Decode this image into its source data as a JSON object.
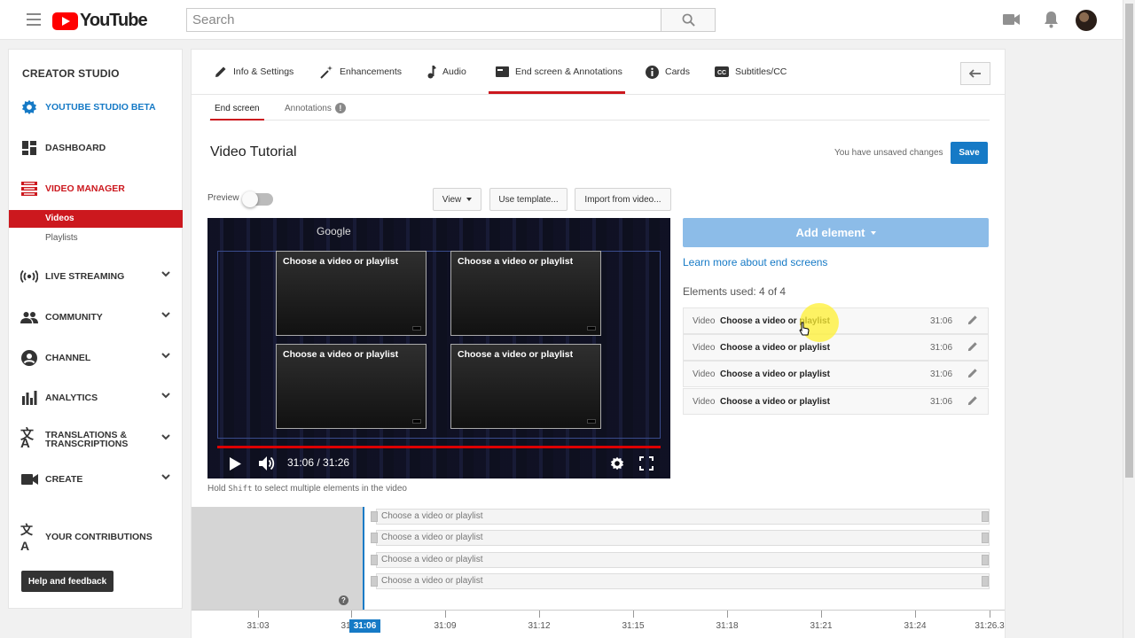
{
  "topbar": {
    "logo_text": "YouTube",
    "search_placeholder": "Search"
  },
  "sidebar": {
    "title": "CREATOR STUDIO",
    "items": [
      {
        "label": "YOUTUBE STUDIO BETA",
        "icon": "gear-icon",
        "accent": true
      },
      {
        "label": "DASHBOARD",
        "icon": "dashboard-icon"
      },
      {
        "label": "VIDEO MANAGER",
        "icon": "video-manager-icon",
        "accent": true
      },
      {
        "label": "LIVE STREAMING",
        "icon": "live-icon"
      },
      {
        "label": "COMMUNITY",
        "icon": "people-icon"
      },
      {
        "label": "CHANNEL",
        "icon": "account-icon"
      },
      {
        "label": "ANALYTICS",
        "icon": "bar-chart-icon"
      },
      {
        "label": "TRANSLATIONS & TRANSCRIPTIONS",
        "icon": "translate-icon"
      },
      {
        "label": "CREATE",
        "icon": "camera-icon"
      },
      {
        "label": "YOUR CONTRIBUTIONS",
        "icon": "translate-icon"
      }
    ],
    "subitems": [
      {
        "label": "Videos"
      },
      {
        "label": "Playlists"
      }
    ],
    "help_button": "Help and feedback"
  },
  "tabs": [
    {
      "label": "Info & Settings",
      "icon": "pencil-icon"
    },
    {
      "label": "Enhancements",
      "icon": "magic-wand-icon"
    },
    {
      "label": "Audio",
      "icon": "music-note-icon"
    },
    {
      "label": "End screen & Annotations",
      "icon": "end-screen-icon"
    },
    {
      "label": "Cards",
      "icon": "info-icon"
    },
    {
      "label": "Subtitles/CC",
      "icon": "cc-icon"
    }
  ],
  "subtabs": [
    {
      "label": "End screen"
    },
    {
      "label": "Annotations"
    }
  ],
  "video": {
    "title": "Video Tutorial",
    "unsaved": "You have unsaved changes",
    "save": "Save",
    "preview_label": "Preview",
    "view_button": "View",
    "template_button": "Use template...",
    "import_button": "Import from video...",
    "watermark": "Google",
    "card_label": "Choose a video or playlist",
    "time_display": "31:06 / 31:26",
    "hint_prefix": "Hold ",
    "hint_key": "Shift",
    "hint_suffix": " to select multiple elements in the video"
  },
  "panel": {
    "add_element": "Add element",
    "learn_more": "Learn more about end screens",
    "elements_used": "Elements used: 4 of 4",
    "elements": [
      {
        "type": "Video",
        "name": "Choose a video or playlist",
        "time": "31:06"
      },
      {
        "type": "Video",
        "name": "Choose a video or playlist",
        "time": "31:06"
      },
      {
        "type": "Video",
        "name": "Choose a video or playlist",
        "time": "31:06"
      },
      {
        "type": "Video",
        "name": "Choose a video or playlist",
        "time": "31:06"
      }
    ]
  },
  "timeline": {
    "rows": [
      "Choose a video or playlist",
      "Choose a video or playlist",
      "Choose a video or playlist",
      "Choose a video or playlist"
    ],
    "ticks": [
      "31:03",
      "31",
      "31:09",
      "31:12",
      "31:15",
      "31:18",
      "31:21",
      "31:24",
      "31:26.3"
    ],
    "playhead_label": "31:06"
  },
  "colors": {
    "accent_red": "#cc181e",
    "save_blue": "#167ac6",
    "add_element_blue": "#8cbce8"
  }
}
